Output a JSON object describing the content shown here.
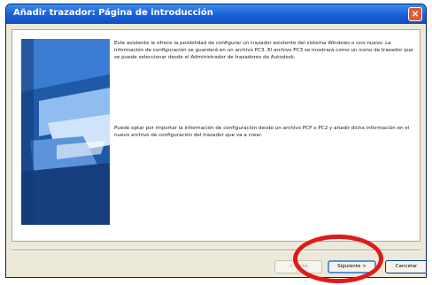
{
  "window": {
    "title": "Añadir trazador: Página de introducción",
    "close_glyph": "×"
  },
  "content": {
    "paragraph_1": "Este asistente le ofrece la posibilidad de configurar un trazador existente del sistema Windows o uno nuevo. La información de configuración se guardará en un archivo PC3. El archivo PC3 se mostrará como un icono de trazador que se puede seleccionar desde el Administrador de trazadores de Autodesk.",
    "paragraph_2": "Puede optar por importar la información de configuración desde un archivo PCP o PC2 y añadir dicha información en el nuevo archivo de configuración del trazador que va a crear."
  },
  "buttons": {
    "back_label": "< Atrás",
    "next_label": "Siguiente >",
    "cancel_label": "Cancelar"
  },
  "colors": {
    "titlebar": "#0b4ec7",
    "highlight_ring": "#e01a1a"
  }
}
